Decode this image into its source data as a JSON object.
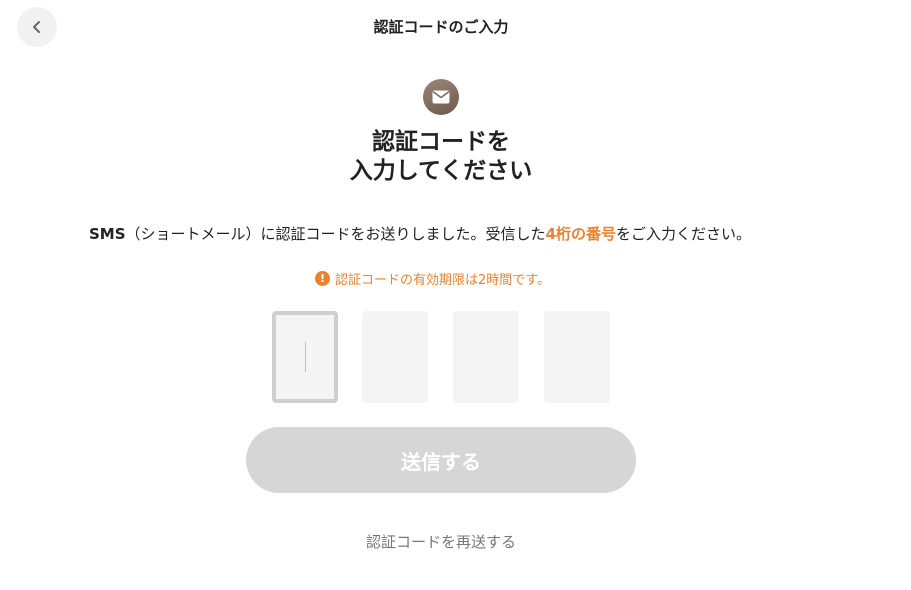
{
  "header": {
    "title": "認証コードのご入力",
    "back_icon": "chevron-left-icon"
  },
  "hero": {
    "icon": "mail-icon",
    "heading_line1": "認証コードを",
    "heading_line2": "入力してください"
  },
  "description": {
    "sms": "SMS",
    "middle": "（ショートメール）に認証コードをお送りしました。受信した",
    "highlight": "4桁の番号",
    "end": "をご入力ください。"
  },
  "notice": {
    "icon_text": "!",
    "text": "認証コードの有効期限は2時間です。"
  },
  "code_inputs": [
    {
      "value": ""
    },
    {
      "value": ""
    },
    {
      "value": ""
    },
    {
      "value": ""
    }
  ],
  "submit": {
    "label": "送信する"
  },
  "resend": {
    "label": "認証コードを再送する"
  },
  "colors": {
    "accent": "#e9832f",
    "button_disabled": "#d5d6d5",
    "badge": "#7d6a5c"
  }
}
